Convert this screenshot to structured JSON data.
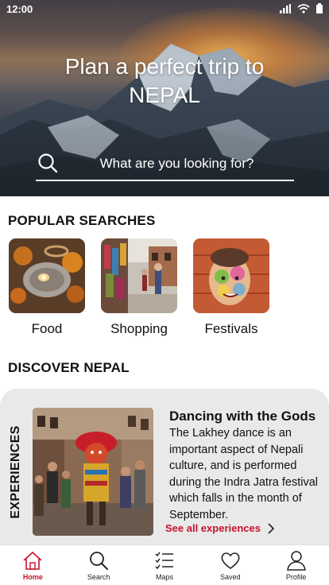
{
  "status_bar": {
    "time": "12:00",
    "icons": [
      "signal-icon",
      "wifi-icon",
      "battery-icon"
    ]
  },
  "hero": {
    "title_line1": "Plan a perfect trip to",
    "title_line2": "NEPAL",
    "search_placeholder": "What are you looking for?"
  },
  "popular": {
    "title": "POPULAR SEARCHES",
    "items": [
      {
        "label": "Food"
      },
      {
        "label": "Shopping"
      },
      {
        "label": "Festivals"
      }
    ]
  },
  "discover": {
    "title": "DISCOVER NEPAL",
    "category": "EXPERIENCES",
    "heading": "Dancing with the Gods",
    "body": "The Lakhey dance is an important aspect of Nepali culture, and is performed during the Indra Jatra festival which falls in the month of September.",
    "link_label": "See all experiences"
  },
  "tabs": [
    {
      "label": "Home",
      "icon": "home-icon",
      "active": true
    },
    {
      "label": "Search",
      "icon": "search-icon"
    },
    {
      "label": "Maps",
      "icon": "checklist-icon"
    },
    {
      "label": "Saved",
      "icon": "heart-icon"
    },
    {
      "label": "Profile",
      "icon": "person-icon"
    }
  ],
  "colors": {
    "accent": "#c8102e",
    "card_bg": "#e9e9e9"
  }
}
